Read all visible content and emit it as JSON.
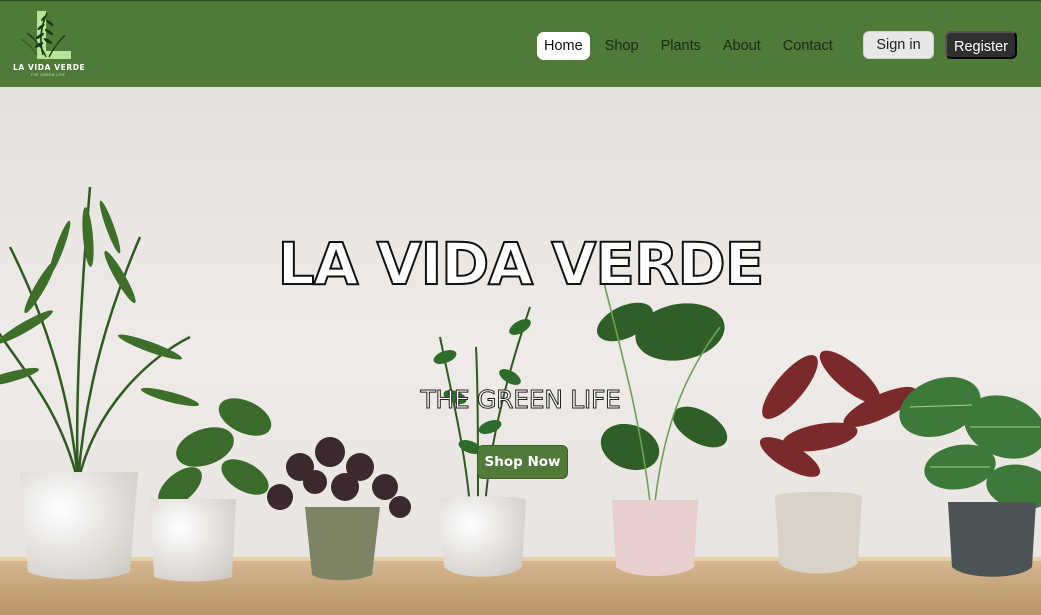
{
  "brand": {
    "name": "LA VIDA VERDE",
    "tagline": "THE GREEN LIFE",
    "logo_letter": "L",
    "logo_icon": "fern-leaf-icon"
  },
  "nav": {
    "items": [
      {
        "label": "Home",
        "active": true
      },
      {
        "label": "Shop",
        "active": false
      },
      {
        "label": "Plants",
        "active": false
      },
      {
        "label": "About",
        "active": false
      },
      {
        "label": "Contact",
        "active": false
      }
    ],
    "sign_in_label": "Sign in",
    "register_label": "Register"
  },
  "hero": {
    "title": "LA VIDA VERDE",
    "subtitle": "THE GREEN LIFE",
    "cta_label": "Shop Now"
  },
  "colors": {
    "nav_bg": "#4f7a37",
    "cta_bg": "#4f7a37",
    "register_bg": "#2f2f2f",
    "wall": "#ece9e6",
    "shelf": "#c9a77f"
  }
}
